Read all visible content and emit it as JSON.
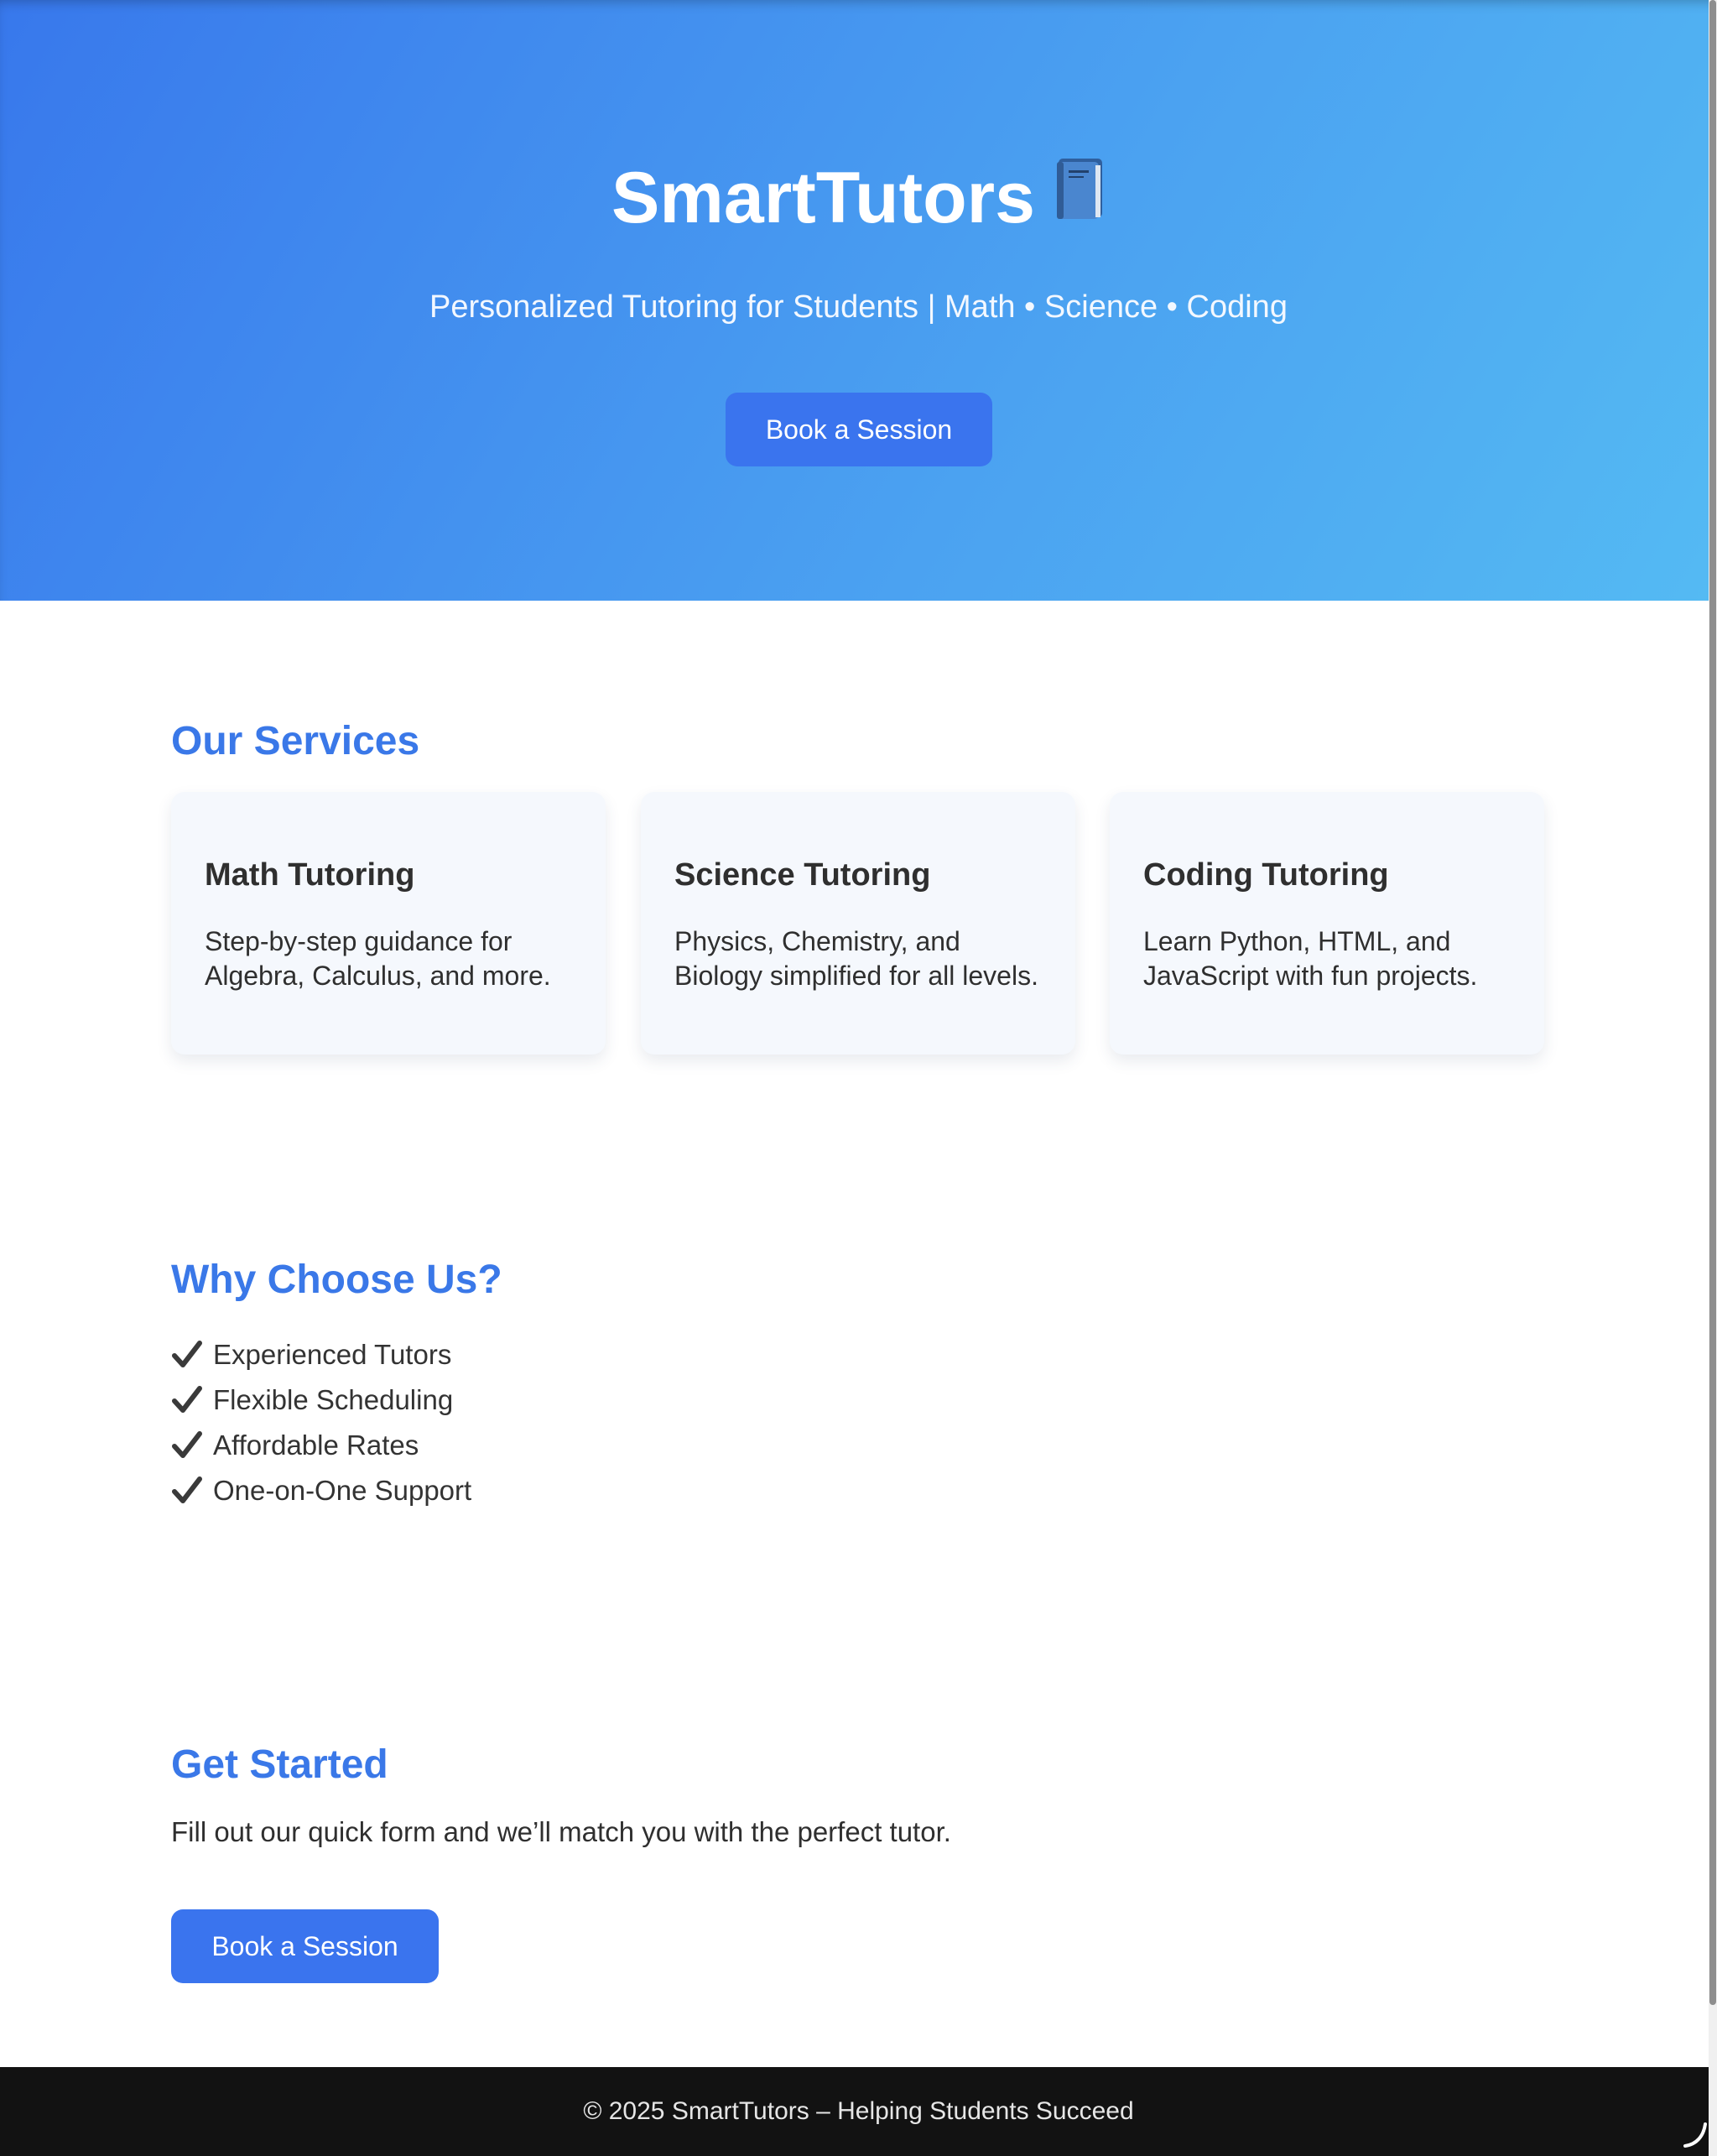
{
  "hero": {
    "title": "SmartTutors",
    "title_icon": "book-icon",
    "subtitle": "Personalized Tutoring for Students | Math • Science • Coding",
    "cta_label": "Book a Session"
  },
  "services": {
    "heading": "Our Services",
    "cards": [
      {
        "title": "Math Tutoring",
        "description": "Step-by-step guidance for Algebra, Calculus, and more."
      },
      {
        "title": "Science Tutoring",
        "description": "Physics, Chemistry, and Biology simplified for all levels."
      },
      {
        "title": "Coding Tutoring",
        "description": "Learn Python, HTML, and JavaScript with fun projects."
      }
    ]
  },
  "why": {
    "heading": "Why Choose Us?",
    "items": [
      "Experienced Tutors",
      "Flexible Scheduling",
      "Affordable Rates",
      "One-on-One Support"
    ]
  },
  "get_started": {
    "heading": "Get Started",
    "text": "Fill out our quick form and we’ll match you with the perfect tutor.",
    "cta_label": "Book a Session"
  },
  "footer": {
    "text": "© 2025 SmartTutors – Helping Students Succeed"
  },
  "colors": {
    "accent": "#3a78e8",
    "button": "#3a74ee",
    "hero_gradient_start": "#3878ec",
    "hero_gradient_end": "#54baf3",
    "footer_bg": "#121212"
  }
}
